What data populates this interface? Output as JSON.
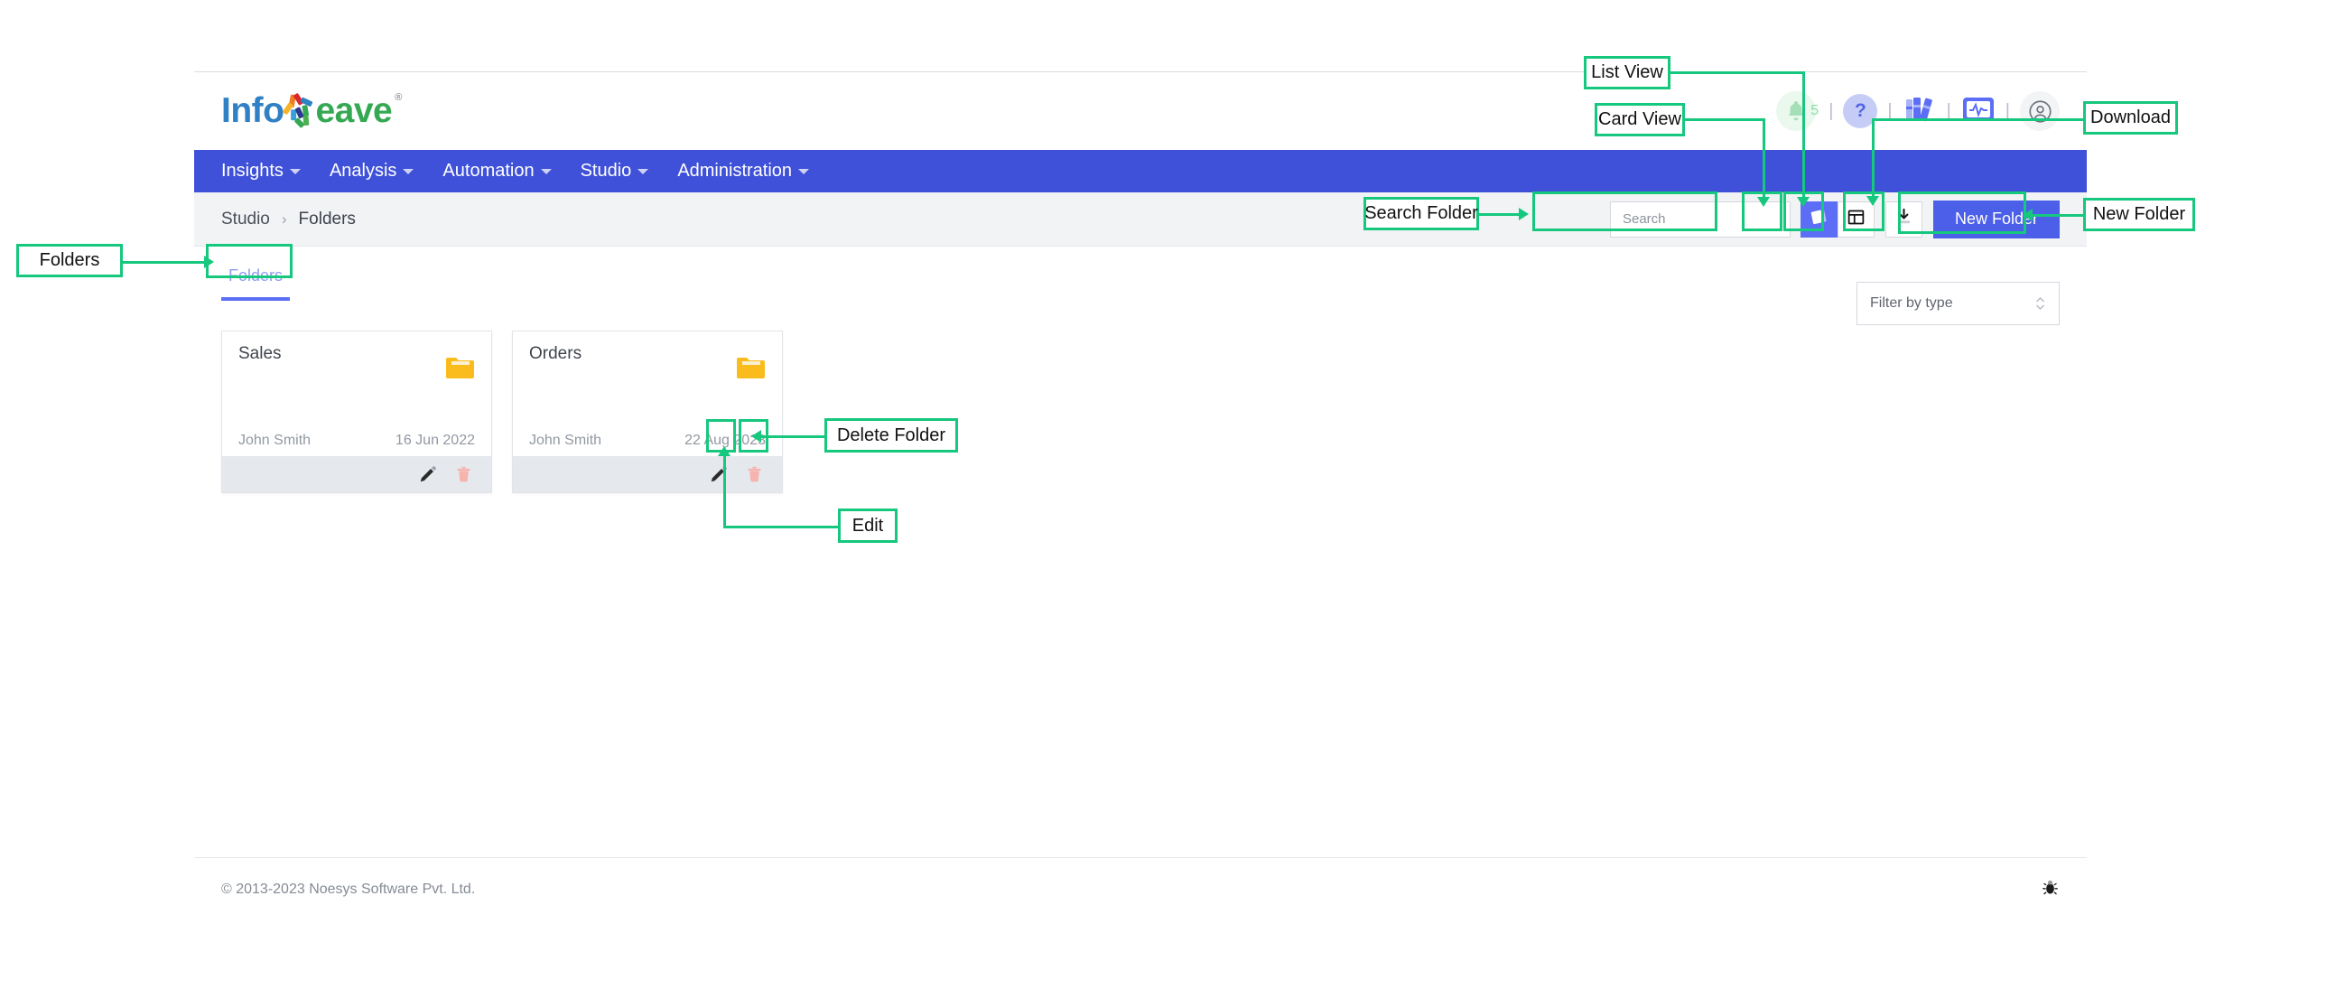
{
  "brand": {
    "name_part1": "Info",
    "name_part2": "eave",
    "registered": "®"
  },
  "header": {
    "notification_count": "5",
    "help_label": "?",
    "icons": [
      "bell-icon",
      "help-icon",
      "library-icon",
      "monitor-icon",
      "user-avatar-icon"
    ],
    "separator": "|"
  },
  "nav": {
    "items": [
      {
        "label": "Insights"
      },
      {
        "label": "Analysis"
      },
      {
        "label": "Automation"
      },
      {
        "label": "Studio"
      },
      {
        "label": "Administration"
      }
    ]
  },
  "breadcrumb": {
    "root": "Studio",
    "separator": "›",
    "current": "Folders"
  },
  "toolbar": {
    "search_placeholder": "Search",
    "search_value": "",
    "card_view_label": "card-view",
    "list_view_label": "list-view",
    "download_label": "download",
    "new_folder_label": "New Folder"
  },
  "tabs": [
    {
      "label": "Folders",
      "active": true
    }
  ],
  "filter": {
    "label": "Filter by type"
  },
  "folders": [
    {
      "name": "Sales",
      "owner": "John Smith",
      "date": "16 Jun 2022"
    },
    {
      "name": "Orders",
      "owner": "John Smith",
      "date": "22 Aug 2023"
    }
  ],
  "footer": {
    "copyright": "© 2013-2023 Noesys Software Pvt. Ltd.",
    "bug_icon": "bug-icon"
  },
  "annotations": {
    "list_view": "List View",
    "card_view": "Card View",
    "download": "Download",
    "new_folder": "New Folder",
    "search_folder": "Search Folder",
    "folders": "Folders",
    "delete_folder": "Delete Folder",
    "edit": "Edit"
  },
  "colors": {
    "nav_blue": "#3f51d8",
    "accent_blue": "#4b5fe8",
    "annotation_green": "#16c77e",
    "folder_yellow": "#f9bc1c",
    "tab_underline": "#5b6ef5"
  }
}
